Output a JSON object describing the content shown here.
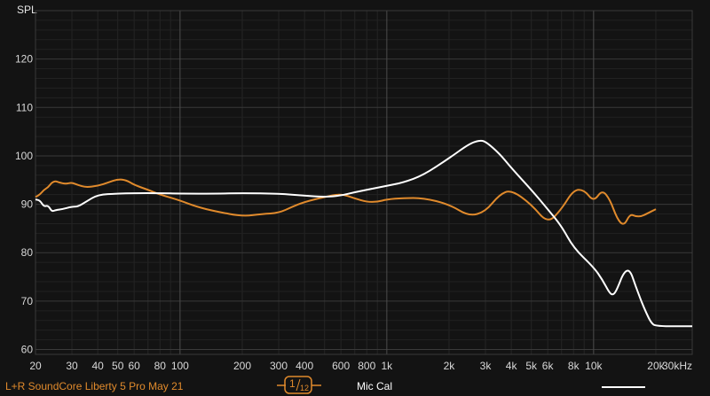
{
  "chart_data": {
    "type": "line",
    "ylabel": "SPL",
    "xscale": "log",
    "xlim": [
      20,
      30000
    ],
    "ylim": [
      59,
      130
    ],
    "grid": true,
    "x_ticks": [
      {
        "v": 20,
        "label": "20"
      },
      {
        "v": 30,
        "label": "30"
      },
      {
        "v": 40,
        "label": "40"
      },
      {
        "v": 50,
        "label": "50"
      },
      {
        "v": 60,
        "label": "60"
      },
      {
        "v": 80,
        "label": "80"
      },
      {
        "v": 100,
        "label": "100"
      },
      {
        "v": 200,
        "label": "200"
      },
      {
        "v": 300,
        "label": "300"
      },
      {
        "v": 400,
        "label": "400"
      },
      {
        "v": 600,
        "label": "600"
      },
      {
        "v": 800,
        "label": "800"
      },
      {
        "v": 1000,
        "label": "1k"
      },
      {
        "v": 2000,
        "label": "2k"
      },
      {
        "v": 3000,
        "label": "3k"
      },
      {
        "v": 4000,
        "label": "4k"
      },
      {
        "v": 5000,
        "label": "5k"
      },
      {
        "v": 6000,
        "label": "6k"
      },
      {
        "v": 8000,
        "label": "8k"
      },
      {
        "v": 10000,
        "label": "10k"
      },
      {
        "v": 20000,
        "label": "20k"
      },
      {
        "v": 30000,
        "label": "30kHz"
      }
    ],
    "y_ticks": [
      60,
      70,
      80,
      90,
      100,
      110,
      120
    ],
    "series": [
      {
        "name": "L+R SoundCore Liberty 5 Pro May 21",
        "color": "#e08a2c",
        "x": [
          20,
          21,
          22,
          23,
          24,
          25,
          26,
          28,
          30,
          32,
          35,
          40,
          45,
          50,
          55,
          60,
          70,
          80,
          100,
          120,
          150,
          200,
          250,
          300,
          350,
          400,
          500,
          600,
          700,
          800,
          900,
          1000,
          1200,
          1500,
          2000,
          2500,
          3000,
          3500,
          4000,
          5000,
          6000,
          7000,
          8000,
          9000,
          10000,
          11000,
          12000,
          13000,
          14000,
          15000,
          16000,
          17000,
          18000,
          20000
        ],
        "y": [
          91.5,
          92,
          93,
          93.5,
          94.5,
          94.8,
          94.5,
          94.2,
          94.5,
          94,
          93.5,
          93.8,
          94.5,
          95.2,
          95,
          94,
          93,
          92,
          90.8,
          89.5,
          88.5,
          87.5,
          88,
          88.2,
          89.5,
          90.5,
          91.5,
          92.2,
          91.2,
          90.5,
          90.5,
          91,
          91.3,
          91.3,
          90,
          87.5,
          88.5,
          92,
          93,
          90,
          86,
          89,
          93,
          93,
          90.5,
          93,
          91,
          87,
          85.5,
          88,
          87.5,
          87.5,
          88,
          89
        ]
      },
      {
        "name": "Mic Cal",
        "color": "#ffffff",
        "x": [
          20,
          21,
          22,
          23,
          24,
          25,
          27,
          30,
          32,
          35,
          40,
          50,
          60,
          80,
          100,
          150,
          200,
          300,
          400,
          500,
          600,
          700,
          800,
          1000,
          1200,
          1500,
          2000,
          2500,
          2800,
          3000,
          3500,
          4000,
          5000,
          6000,
          7000,
          8000,
          10000,
          11000,
          12000,
          12500,
          13000,
          14000,
          15000,
          16000,
          17000,
          18000,
          19000,
          20000,
          30000
        ],
        "y": [
          91,
          90.8,
          89.5,
          89.8,
          88.5,
          88.8,
          89,
          89.5,
          89.5,
          90.5,
          92,
          92.2,
          92.3,
          92.3,
          92.2,
          92.2,
          92.3,
          92.2,
          91.8,
          91.5,
          91.8,
          92.5,
          93,
          93.8,
          94.5,
          96,
          99.5,
          102.5,
          103.2,
          103,
          100.5,
          97.5,
          93,
          89,
          85.5,
          81,
          77,
          74.5,
          71.5,
          71.3,
          72.5,
          76,
          76.5,
          73,
          70,
          67.5,
          65.5,
          64.8,
          64.8
        ]
      }
    ]
  },
  "legend": {
    "series1_label": "L+R SoundCore Liberty 5 Pro May 21",
    "smoothing_numerator": "1",
    "smoothing_denominator": "12",
    "series2_label": "Mic Cal"
  }
}
